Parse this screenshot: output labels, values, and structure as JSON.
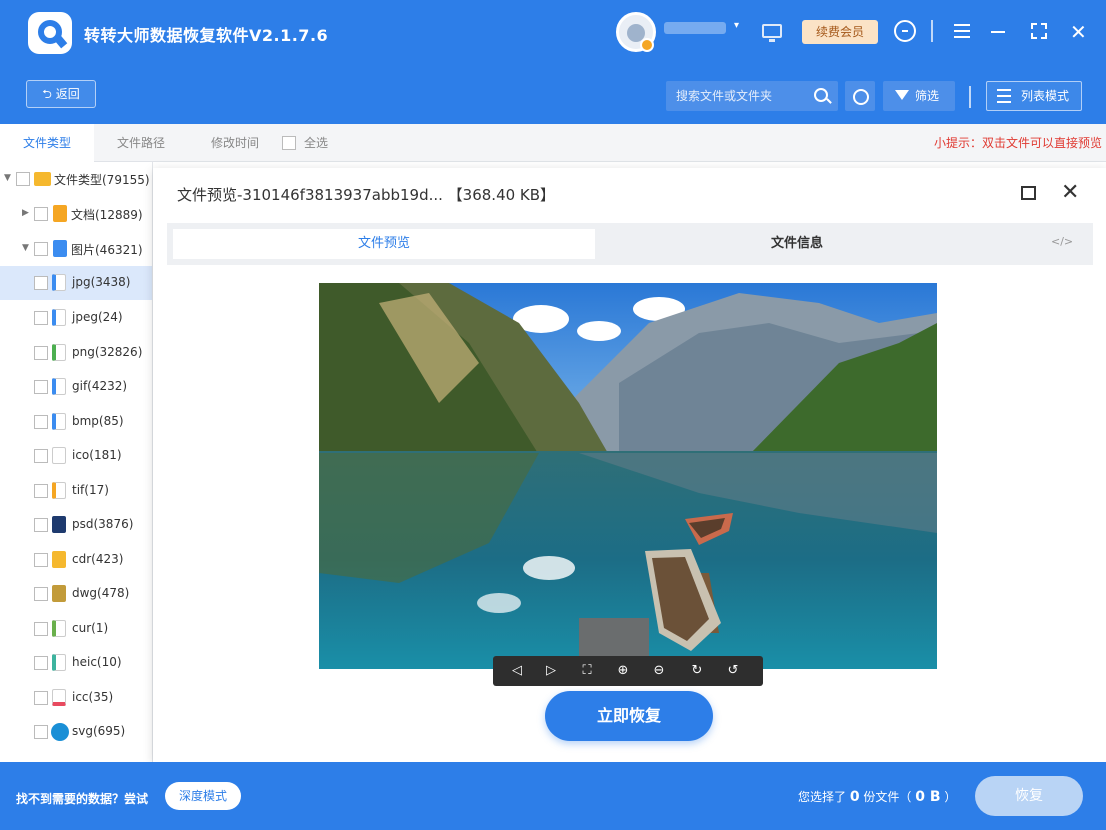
{
  "app": {
    "title": "转转大师数据恢复软件V2.1.7.6",
    "vip_label": "续费会员",
    "close_glyph": "✕",
    "caret": "▾"
  },
  "toolbar": {
    "back_label": "⮌ 返回",
    "search_placeholder": "搜索文件或文件夹",
    "filter_label": "筛选",
    "view_label": "列表模式"
  },
  "tabs": [
    {
      "label": "文件类型",
      "active": true
    },
    {
      "label": "文件路径",
      "active": false
    },
    {
      "label": "修改时间",
      "active": false
    }
  ],
  "select_all_label": "全选",
  "tip": "小提示：双击文件可以直接预览",
  "tree": [
    {
      "label": "文件类型(79155)",
      "arrow": "▼",
      "icon": "folder-icon",
      "color": "#f5b82e"
    },
    {
      "label": "文档(12889)",
      "arrow": "▶",
      "icon": "document-icon",
      "color": "#f5a623"
    },
    {
      "label": "图片(46321)",
      "arrow": "▼",
      "icon": "image-icon",
      "color": "#3b8cf0"
    },
    {
      "label": "jpg(3438)",
      "icon": "jpg-icon",
      "color": "#3b8cf0"
    },
    {
      "label": "jpeg(24)",
      "icon": "jpeg-icon",
      "color": "#3b8cf0"
    },
    {
      "label": "png(32826)",
      "icon": "png-icon",
      "color": "#4caf50"
    },
    {
      "label": "gif(4232)",
      "icon": "gif-icon",
      "color": "#3b8cf0"
    },
    {
      "label": "bmp(85)",
      "icon": "bmp-icon",
      "color": "#3b8cf0"
    },
    {
      "label": "ico(181)",
      "icon": "ico-icon",
      "color": "#ffffff"
    },
    {
      "label": "tif(17)",
      "icon": "tif-icon",
      "color": "#f5a623"
    },
    {
      "label": "psd(3876)",
      "icon": "psd-icon",
      "color": "#1e3a6e"
    },
    {
      "label": "cdr(423)",
      "icon": "cdr-icon",
      "color": "#f5b82e"
    },
    {
      "label": "dwg(478)",
      "icon": "dwg-icon",
      "color": "#c29b3a"
    },
    {
      "label": "cur(1)",
      "icon": "cur-icon",
      "color": "#6ab04c"
    },
    {
      "label": "heic(10)",
      "icon": "heic-icon",
      "color": "#3db39e"
    },
    {
      "label": "icc(35)",
      "icon": "icc-icon",
      "color": "#e84a5f"
    },
    {
      "label": "svg(695)",
      "icon": "svg-icon",
      "color": "#1a8fd6"
    }
  ],
  "modal": {
    "title": "文件预览-310146f3813937abb19d... 【368.40 KB】",
    "tab_preview": "文件预览",
    "tab_info": "文件信息",
    "code_glyph": "</>",
    "close_glyph": "✕",
    "recover_now": "立即恢复",
    "controls": [
      {
        "name": "prev-icon",
        "glyph": "◁"
      },
      {
        "name": "next-icon",
        "glyph": "▷"
      },
      {
        "name": "fit-icon",
        "glyph": "⛶"
      },
      {
        "name": "zoom-in-icon",
        "glyph": "⊕"
      },
      {
        "name": "zoom-out-icon",
        "glyph": "⊖"
      },
      {
        "name": "rotate-right-icon",
        "glyph": "↻"
      },
      {
        "name": "rotate-left-icon",
        "glyph": "↺"
      }
    ]
  },
  "footer": {
    "tip": "找不到需要的数据？尝试",
    "deep_label": "深度模式",
    "sel_prefix": "您选择了",
    "sel_count": "0",
    "sel_mid": "份文件（",
    "sel_size": "0 B",
    "sel_suffix": "）",
    "recover_label": "恢复"
  }
}
